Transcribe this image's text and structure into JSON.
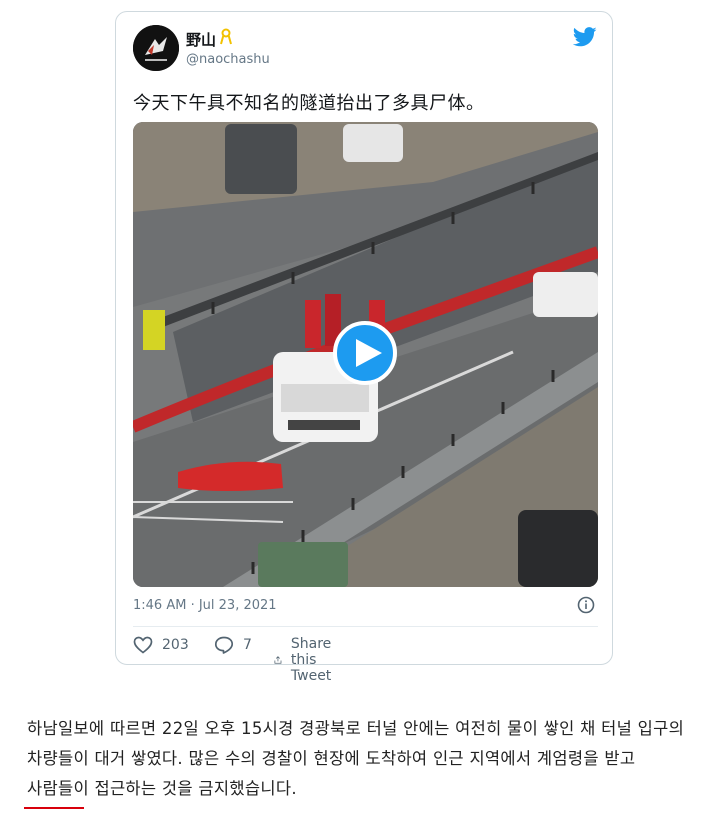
{
  "tweet": {
    "display_name": "野山",
    "handle": "@naochashu",
    "text": "今天下午具不知名的隧道抬出了多具尸体。",
    "timestamp": "1:46 AM · Jul 23, 2021",
    "likes": "203",
    "replies": "7",
    "share_label": "Share this Tweet",
    "icons": [
      "twitter-bird-icon",
      "ribbon-icon",
      "play-icon",
      "info-icon",
      "heart-icon",
      "reply-icon",
      "share-icon"
    ],
    "colors": {
      "brand": "#1d9bf0",
      "text": "#14171a",
      "muted": "#657786"
    }
  },
  "article": {
    "caption": "하남일보에 따르면 22일 오후 15시경 경광북로 터널 안에는 여전히 물이 쌓인 채 터널 입구의 차량들이 대거 쌓였다. 많은 수의 경찰이 현장에 도착하여 인근 지역에서 계엄령을 받고 사람들이 접근하는 것을 금지했습니다.",
    "underline_color": "#d8000c"
  }
}
